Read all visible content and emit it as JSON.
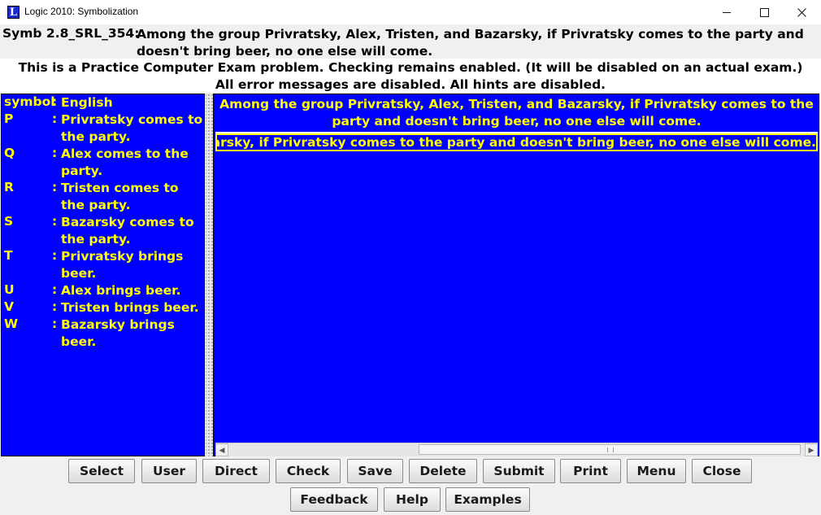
{
  "window": {
    "title": "Logic 2010: Symbolization",
    "app_icon_letter": "L"
  },
  "problem": {
    "id": "Symb 2.8_SRL_354:",
    "text": "Among the group Privratsky, Alex, Tristen, and Bazarsky, if Privratsky comes to the party and doesn't bring beer, no one else will come."
  },
  "notice": "This is a Practice Computer Exam problem. Checking remains enabled. (It will be disabled on an actual exam.) All error messages are disabled. All hints are disabled.",
  "legend": {
    "header_symbol": "symbol",
    "header_colon": ":",
    "header_english": "English",
    "rows": [
      {
        "symbol": "P",
        "english": "Privratsky comes to the party."
      },
      {
        "symbol": "Q",
        "english": "Alex comes to the party."
      },
      {
        "symbol": "R",
        "english": "Tristen comes to the party."
      },
      {
        "symbol": "S",
        "english": "Bazarsky comes to the party."
      },
      {
        "symbol": "T",
        "english": "Privratsky brings beer."
      },
      {
        "symbol": "U",
        "english": "Alex brings beer."
      },
      {
        "symbol": "V",
        "english": "Tristen brings beer."
      },
      {
        "symbol": "W",
        "english": "Bazarsky brings beer."
      }
    ]
  },
  "main": {
    "english_sentence": "Among the group Privratsky, Alex, Tristen, and Bazarsky, if Privratsky comes to the party and doesn't bring beer, no one else will come.",
    "answer_value": "nd Bazarsky, if Privratsky comes to the party and doesn't bring beer, no one else will come."
  },
  "buttons": {
    "select": "Select",
    "user": "User",
    "direct": "Direct",
    "check": "Check",
    "save": "Save",
    "delete": "Delete",
    "submit": "Submit",
    "print": "Print",
    "menu": "Menu",
    "close": "Close",
    "feedback": "Feedback",
    "help": "Help",
    "examples": "Examples"
  },
  "colors": {
    "panel_background": "#0000ff",
    "panel_text": "#ffff00"
  },
  "icons": {
    "minimize": "minimize-icon",
    "maximize": "maximize-icon",
    "close": "close-icon"
  }
}
